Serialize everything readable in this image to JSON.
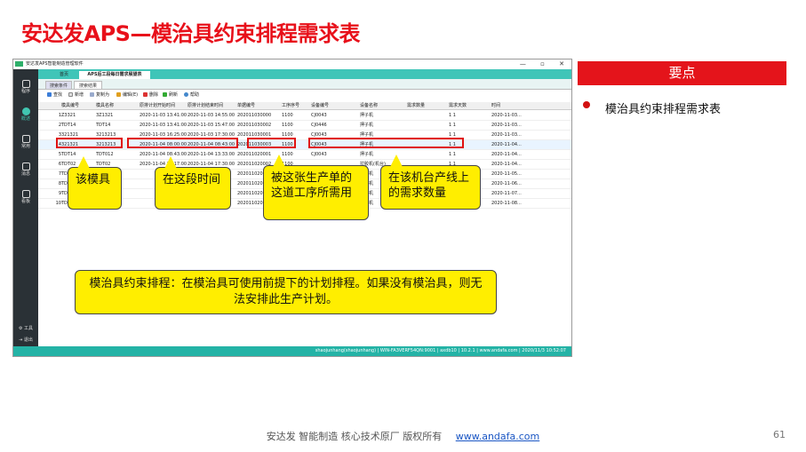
{
  "slide": {
    "title": "安达发APS—模治具约束排程需求表",
    "key_header": "要点",
    "key_point": "模治具约束排程需求表",
    "footer_text": "安达发  智能制造 核心技术原厂   版权所有",
    "footer_link": "www.andafa.com",
    "page_number": "61"
  },
  "app": {
    "window_title": "安达发APS智能制造管理软件",
    "window_buttons": [
      "—",
      "▫",
      "✕"
    ],
    "nav": [
      {
        "label": "程序",
        "icon": "grid-icon"
      },
      {
        "label": "概述",
        "icon": "clock-icon"
      },
      {
        "label": "常用",
        "icon": "star-icon"
      },
      {
        "label": "消息",
        "icon": "chat-icon"
      },
      {
        "label": "看板",
        "icon": "chart-icon"
      }
    ],
    "nav_bottom": [
      {
        "label": "工具",
        "icon": "gear-icon"
      },
      {
        "label": "退出",
        "icon": "exit-icon"
      }
    ],
    "tabs": [
      "首页",
      "APS后工段每日需求展望表"
    ],
    "subtabs": [
      "搜索条件",
      "搜索结果"
    ],
    "toolbar": [
      "查找",
      "新增",
      "复制为",
      "编辑(E)",
      "删除",
      "刷新",
      "帮助"
    ],
    "columns": [
      "模具编号",
      "模具名称",
      "原排计划开始时间",
      "原排计划结束时间",
      "单据编号",
      "工序序号",
      "设备编号",
      "设备名称",
      "需求数量",
      "需求天数",
      "时间"
    ],
    "rows": [
      [
        "1",
        "Z3321",
        "3Z1321",
        "2020-11-03 13:41:00",
        "2020-11-03 14:55:00",
        "202011030000",
        "1100",
        "CJ0043",
        "押子机",
        "",
        "1 1",
        "2020-11-03..."
      ],
      [
        "2",
        "TDT14",
        "TDT14",
        "2020-11-03 13:41:00",
        "2020-11-03 15:47:00",
        "202011030002",
        "1100",
        "CJ0446",
        "押子机",
        "",
        "1 1",
        "2020-11-03..."
      ],
      [
        "3",
        "321321",
        "3213213",
        "2020-11-03 16:25:00",
        "2020-11-03 17:30:00",
        "202011030001",
        "1100",
        "CJ0043",
        "押子机",
        "",
        "1 1",
        "2020-11-03..."
      ],
      [
        "4",
        "321321",
        "3213213",
        "2020-11-04 08:00:00",
        "2020-11-04 08:43:00",
        "202011030003",
        "1100",
        "CJ0043",
        "押子机",
        "",
        "1 1",
        "2020-11-04..."
      ],
      [
        "5",
        "TDT14",
        "TDT012",
        "2020-11-04 08:43:00",
        "2020-11-04 13:33:00",
        "202011020001",
        "1100",
        "CJ0043",
        "押子机",
        "",
        "1 1",
        "2020-11-04..."
      ],
      [
        "6",
        "TDT02",
        "TDT02",
        "2020-11-04 15:17:00",
        "2020-11-04 17:30:00",
        "202011020002",
        "1100",
        "",
        "拉胶机(机台)",
        "",
        "1 1",
        "2020-11-04..."
      ],
      [
        "7",
        "TDT14",
        "",
        "",
        "",
        "202011020003",
        "1100",
        "",
        "拉胶机",
        "",
        "1 1",
        "2020-11-05..."
      ],
      [
        "8",
        "TDT14",
        "",
        "",
        "",
        "202011020004",
        "1100",
        "",
        "拉胶机",
        "",
        "1 1",
        "2020-11-06..."
      ],
      [
        "9",
        "TDT14",
        "",
        "",
        "",
        "202011020005",
        "1100",
        "",
        "拉胶机",
        "",
        "1 1",
        "2020-11-07..."
      ],
      [
        "10",
        "TDT14",
        "",
        "",
        "",
        "202011020006",
        "1100",
        "",
        "拉胶机",
        "",
        "1 1",
        "2020-11-08..."
      ]
    ],
    "status": "shaojunhang(shaojunhang)  |  WIN-FA3VERF54QN:9001  |  axdb10  |  10.2.1  |  www.andafa.com  |  2020/11/3 10:52:07"
  },
  "callouts": {
    "mold": "该模具",
    "period": "在这段时间",
    "process": "被这张生产单的这道工序所需用",
    "quantity": "在该机台产线上的需求数量",
    "summary": "模治具约束排程：在模治具可使用前提下的计划排程。如果没有模治具，则无法安排此生产计划。"
  },
  "colors": {
    "title_red": "#e8101a",
    "teal": "#3fc5b8",
    "callout_yellow": "#ffee00"
  }
}
